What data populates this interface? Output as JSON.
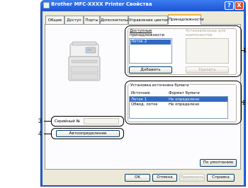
{
  "window": {
    "title": "Brother MFC-XXXX  Printer Свойства",
    "help_label": "?",
    "close_label": "X"
  },
  "tabs": [
    {
      "label": "Общие"
    },
    {
      "label": "Доступ"
    },
    {
      "label": "Порты"
    },
    {
      "label": "Дополнительно"
    },
    {
      "label": "Управление цветом"
    },
    {
      "label": "Принадлежности"
    }
  ],
  "available_options": {
    "label_line1": "Доступные",
    "label_line2": "принадлежности",
    "items": [
      "Лоток 2"
    ],
    "add_button": "Добавить"
  },
  "installed_options": {
    "label_line1": "Установленные для",
    "label_line2": "компонентов",
    "remove_button": "Удалить"
  },
  "paper_source": {
    "label": "Установка источника бумаги",
    "col_source": "Источник",
    "col_format": "Формат бумаги",
    "rows": [
      {
        "source": "Лоток 1",
        "format": "Не определено"
      },
      {
        "source": "Обвод. лоток",
        "format": "Не определено"
      }
    ]
  },
  "serial": {
    "label": "Серийный №",
    "value": ""
  },
  "auto_detect_button": "Автоопределение",
  "default_button": "По умолчанию",
  "footer": {
    "ok": "OK",
    "cancel": "Отмена",
    "apply": "Применить",
    "help": "Справка"
  },
  "callouts": [
    "1",
    "2",
    "3",
    "4"
  ]
}
